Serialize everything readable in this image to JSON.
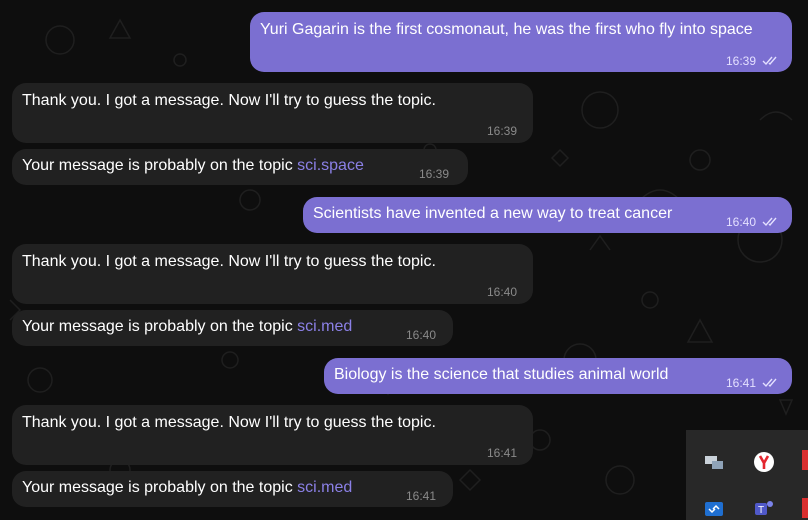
{
  "messages": [
    {
      "dir": "out",
      "text": "Yuri Gagarin is the first cosmonaut, he was the first who fly into space",
      "time": "16:39"
    },
    {
      "dir": "in",
      "text": "Thank you. I got a message. Now I'll try to guess the topic.",
      "time": "16:39"
    },
    {
      "dir": "in",
      "prefix": "Your message is probably on the topic ",
      "topic": "sci.space",
      "time": "16:39"
    },
    {
      "dir": "out",
      "text": "Scientists have invented a new way to treat cancer",
      "time": "16:40"
    },
    {
      "dir": "in",
      "text": "Thank you. I got a message. Now I'll try to guess the topic.",
      "time": "16:40"
    },
    {
      "dir": "in",
      "prefix": "Your message is probably on the topic ",
      "topic": "sci.med",
      "time": "16:40"
    },
    {
      "dir": "out",
      "text": "Biology is the science that studies animal world",
      "time": "16:41"
    },
    {
      "dir": "in",
      "text": "Thank you. I got a message. Now I'll try to guess the topic.",
      "time": "16:41"
    },
    {
      "dir": "in",
      "prefix": "Your message is probably on the topic ",
      "topic": "sci.med",
      "time": "16:41"
    }
  ],
  "colors": {
    "background": "#0e0e0e",
    "incoming_bubble": "#212121",
    "outgoing_bubble": "#7b6fd1",
    "topic_link": "#8b80e6"
  },
  "tray_icons": [
    "network-device-icon",
    "yandex-browser-icon",
    "teams-icon",
    "remote-desktop-icon"
  ]
}
